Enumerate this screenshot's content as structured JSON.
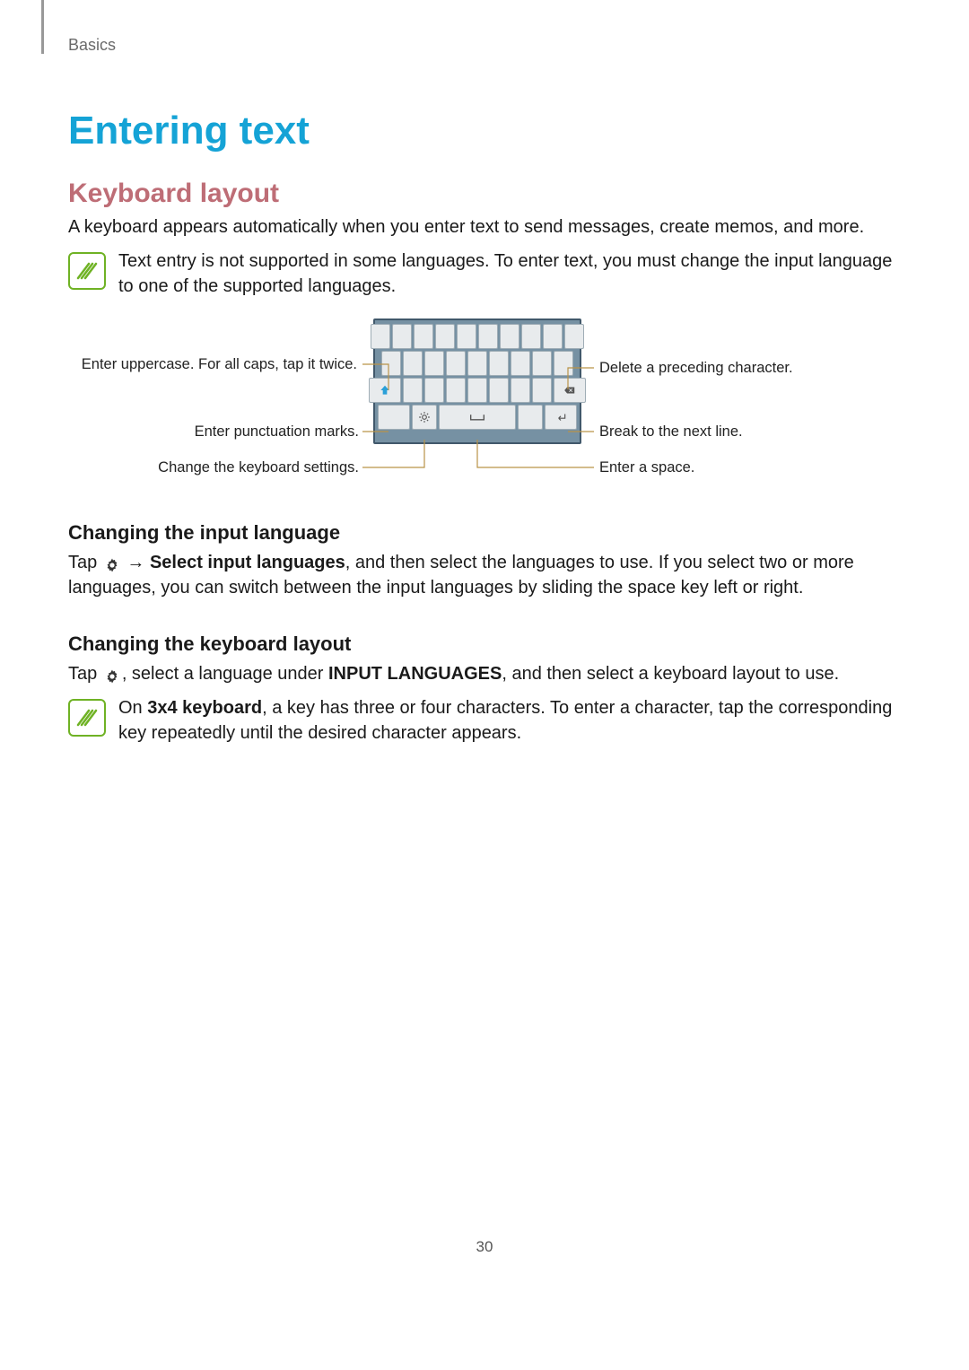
{
  "section": "Basics",
  "title": "Entering text",
  "h2_keyboard": "Keyboard layout",
  "p_keyboard": "A keyboard appears automatically when you enter text to send messages, create memos, and more.",
  "note1": "Text entry is not supported in some languages. To enter text, you must change the input language to one of the supported languages.",
  "callouts": {
    "uppercase": "Enter uppercase. For all caps, tap it twice.",
    "punct": "Enter punctuation marks.",
    "settings": "Change the keyboard settings.",
    "delete": "Delete a preceding character.",
    "break": "Break to the next line.",
    "space": "Enter a space."
  },
  "h3_input_lang": "Changing the input language",
  "p_input_lang_1": "Tap ",
  "p_input_lang_arrow": " → ",
  "p_input_lang_bold": "Select input languages",
  "p_input_lang_2": ", and then select the languages to use. If you select two or more languages, you can switch between the input languages by sliding the space key left or right.",
  "h3_kbd_layout": "Changing the keyboard layout",
  "p_kbd_layout_1": "Tap ",
  "p_kbd_layout_2": ", select a language under ",
  "p_kbd_layout_bold": "INPUT LANGUAGES",
  "p_kbd_layout_3": ", and then select a keyboard layout to use.",
  "note2_pre": "On ",
  "note2_bold": "3x4 keyboard",
  "note2_post": ", a key has three or four characters. To enter a character, tap the corresponding key repeatedly until the desired character appears.",
  "page_number": "30"
}
